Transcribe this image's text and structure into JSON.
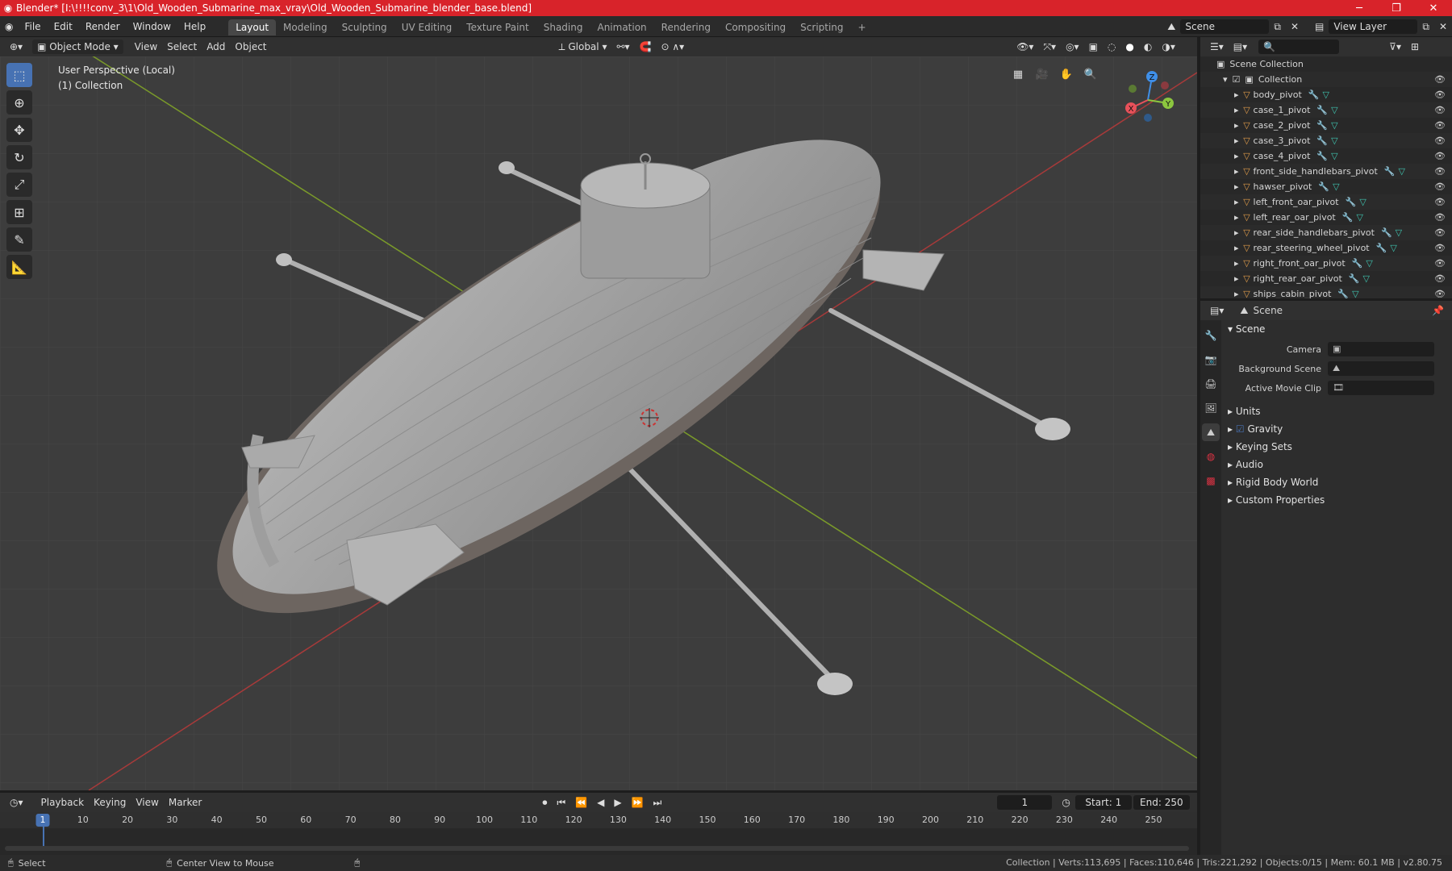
{
  "window": {
    "title": "Blender* [I:\\!!!!conv_3\\1\\Old_Wooden_Submarine_max_vray\\Old_Wooden_Submarine_blender_base.blend]",
    "minimize": "─",
    "maximize": "❐",
    "close": "✕"
  },
  "menu": [
    "File",
    "Edit",
    "Render",
    "Window",
    "Help"
  ],
  "workspaces": [
    "Layout",
    "Modeling",
    "Sculpting",
    "UV Editing",
    "Texture Paint",
    "Shading",
    "Animation",
    "Rendering",
    "Compositing",
    "Scripting"
  ],
  "active_workspace": "Layout",
  "topright": {
    "scene": "Scene",
    "view_layer": "View Layer"
  },
  "viewport_header": {
    "mode": "Object Mode",
    "menus": [
      "View",
      "Select",
      "Add",
      "Object"
    ],
    "orientation": "Global"
  },
  "viewport": {
    "perspective": "User Perspective (Local)",
    "collection": "(1) Collection",
    "gizmo": {
      "x": "X",
      "y": "Y",
      "z": "Z"
    }
  },
  "outliner": {
    "root": "Scene Collection",
    "collection": "Collection",
    "items": [
      "body_pivot",
      "case_1_pivot",
      "case_2_pivot",
      "case_3_pivot",
      "case_4_pivot",
      "front_side_handlebars_pivot",
      "hawser_pivot",
      "left_front_oar_pivot",
      "left_rear_oar_pivot",
      "rear_side_handlebars_pivot",
      "rear_steering_wheel_pivot",
      "right_front_oar_pivot",
      "right_rear_oar_pivot",
      "ships_cabin_pivot"
    ]
  },
  "properties": {
    "context": "Scene",
    "panel": "Scene",
    "camera_label": "Camera",
    "background_scene_label": "Background Scene",
    "active_movie_clip_label": "Active Movie Clip",
    "subpanels": [
      "Units",
      "Gravity",
      "Keying Sets",
      "Audio",
      "Rigid Body World",
      "Custom Properties"
    ]
  },
  "timeline": {
    "menus": [
      "Playback",
      "Keying",
      "View",
      "Marker"
    ],
    "current_frame": "1",
    "start_label": "Start:",
    "start": "1",
    "end_label": "End:",
    "end": "250",
    "ticks": [
      "1",
      "10",
      "20",
      "30",
      "40",
      "50",
      "60",
      "70",
      "80",
      "90",
      "100",
      "110",
      "120",
      "130",
      "140",
      "150",
      "160",
      "170",
      "180",
      "190",
      "200",
      "210",
      "220",
      "230",
      "240",
      "250"
    ]
  },
  "status": {
    "select": "Select",
    "center_view": "Center View to Mouse",
    "stats": "Collection | Verts:113,695 | Faces:110,646 | Tris:221,292 | Objects:0/15 | Mem: 60.1 MB | v2.80.75"
  },
  "colors": {
    "titlebar": "#d8232a",
    "accent": "#4772b3",
    "object_icon": "#e09c4a",
    "mesh_icon": "#3fc4b0",
    "axis_x": "#e8515a",
    "axis_y": "#8cc63f",
    "axis_z": "#3f8fe8"
  }
}
